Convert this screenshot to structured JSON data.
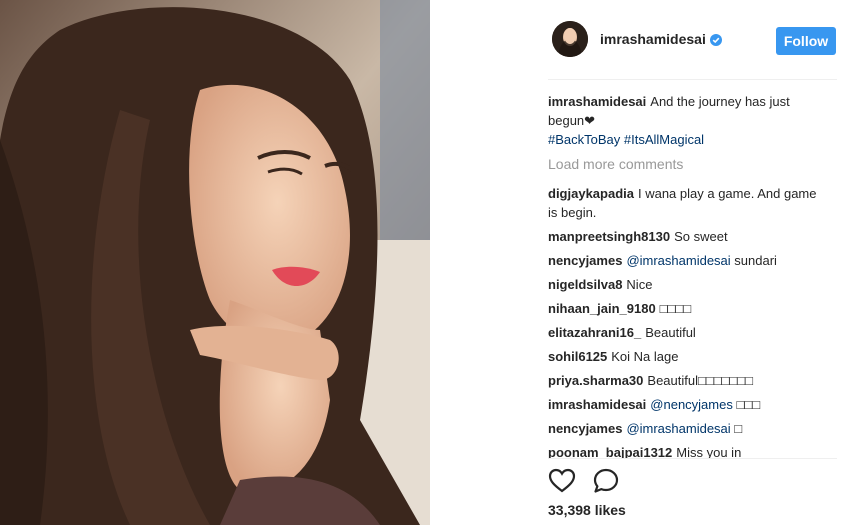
{
  "post": {
    "author": "imrashamidesai",
    "follow_label": "Follow",
    "verified_icon": "verified-badge-icon"
  },
  "caption": {
    "user": "imrashamidesai",
    "text": "And the journey has just begun❤",
    "hashtags": "#BackToBay #ItsAllMagical"
  },
  "load_more_label": "Load more comments",
  "comments": [
    {
      "user": "digjaykapadia",
      "text": "I wana play a game. And game is begin."
    },
    {
      "user": "manpreetsingh8130",
      "text": "So sweet"
    },
    {
      "user": "nencyjames",
      "mention": "@imrashamidesai",
      "text": "sundari"
    },
    {
      "user": "nigeldsilva8",
      "text": "Nice"
    },
    {
      "user": "nihaan_jain_9180",
      "text": "□□□□"
    },
    {
      "user": "elitazahrani16_",
      "text": "Beautiful"
    },
    {
      "user": "sohil6125",
      "text": "Koi Na lage"
    },
    {
      "user": "priya.sharma30",
      "text": "Beautiful□□□□□□□"
    },
    {
      "user": "imrashamidesai",
      "mention": "@nencyjames",
      "text": "□□□"
    },
    {
      "user": "nencyjames",
      "mention": "@imrashamidesai",
      "text": "□"
    },
    {
      "user": "poonam_bajpai1312",
      "text": "Miss you in"
    }
  ],
  "actions": {
    "like_icon": "heart-icon",
    "comment_icon": "comment-bubble-icon"
  },
  "likes": "33,398 likes",
  "colors": {
    "follow_bg": "#3897f0",
    "link": "#003569",
    "muted": "#999999"
  }
}
